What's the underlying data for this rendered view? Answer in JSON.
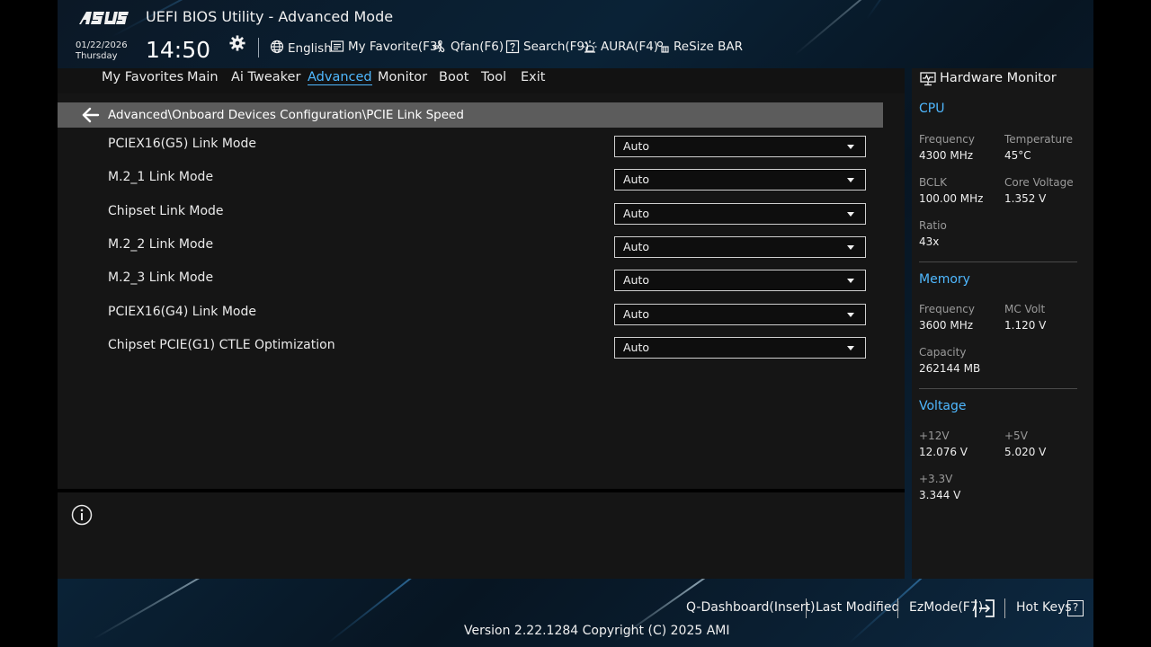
{
  "header": {
    "title": "UEFI BIOS Utility - Advanced Mode",
    "date": "01/22/2026",
    "day": "Thursday",
    "time": "14:50",
    "tools": {
      "language": "English",
      "favorite": "My Favorite(F3)",
      "qfan": "Qfan(F6)",
      "search": "Search(F9)",
      "aura": "AURA(F4)",
      "resizebar": "ReSize BAR"
    }
  },
  "nav": {
    "favorites": "My Favorites",
    "main": "Main",
    "tweaker": "Ai Tweaker",
    "advanced": "Advanced",
    "monitor": "Monitor",
    "boot": "Boot",
    "tool": "Tool",
    "exit": "Exit",
    "active": "Advanced"
  },
  "breadcrumb": "Advanced\\Onboard Devices Configuration\\PCIE Link Speed",
  "settings": [
    {
      "label": "PCIEX16(G5) Link Mode",
      "value": "Auto"
    },
    {
      "label": "M.2_1 Link Mode",
      "value": "Auto"
    },
    {
      "label": "Chipset Link Mode",
      "value": "Auto"
    },
    {
      "label": "M.2_2 Link Mode",
      "value": "Auto"
    },
    {
      "label": "M.2_3 Link Mode",
      "value": "Auto"
    },
    {
      "label": "PCIEX16(G4) Link Mode",
      "value": "Auto"
    },
    {
      "label": "Chipset PCIE(G1) CTLE Optimization",
      "value": "Auto"
    }
  ],
  "hw": {
    "title": "Hardware Monitor",
    "cpu": {
      "heading": "CPU",
      "freq_label": "Frequency",
      "freq": "4300 MHz",
      "temp_label": "Temperature",
      "temp": "45°C",
      "bclk_label": "BCLK",
      "bclk": "100.00 MHz",
      "vcore_label": "Core Voltage",
      "vcore": "1.352 V",
      "ratio_label": "Ratio",
      "ratio": "43x"
    },
    "memory": {
      "heading": "Memory",
      "freq_label": "Frequency",
      "freq": "3600 MHz",
      "mcvolt_label": "MC Volt",
      "mcvolt": "1.120 V",
      "cap_label": "Capacity",
      "cap": "262144 MB"
    },
    "voltage": {
      "heading": "Voltage",
      "v12_label": "+12V",
      "v12": "12.076 V",
      "v5_label": "+5V",
      "v5": "5.020 V",
      "v33_label": "+3.3V",
      "v33": "3.344 V"
    }
  },
  "footer": {
    "qdash": "Q-Dashboard(Insert)",
    "lastmod": "Last Modified",
    "ezmode": "EzMode(F7)",
    "hotkeys": "Hot Keys",
    "hotkeys_key": "?",
    "version": "Version 2.22.1284 Copyright (C) 2025 AMI"
  },
  "colors": {
    "accent": "#4fb8ff",
    "panel": "#151515",
    "crumb": "#5c5c5c"
  }
}
